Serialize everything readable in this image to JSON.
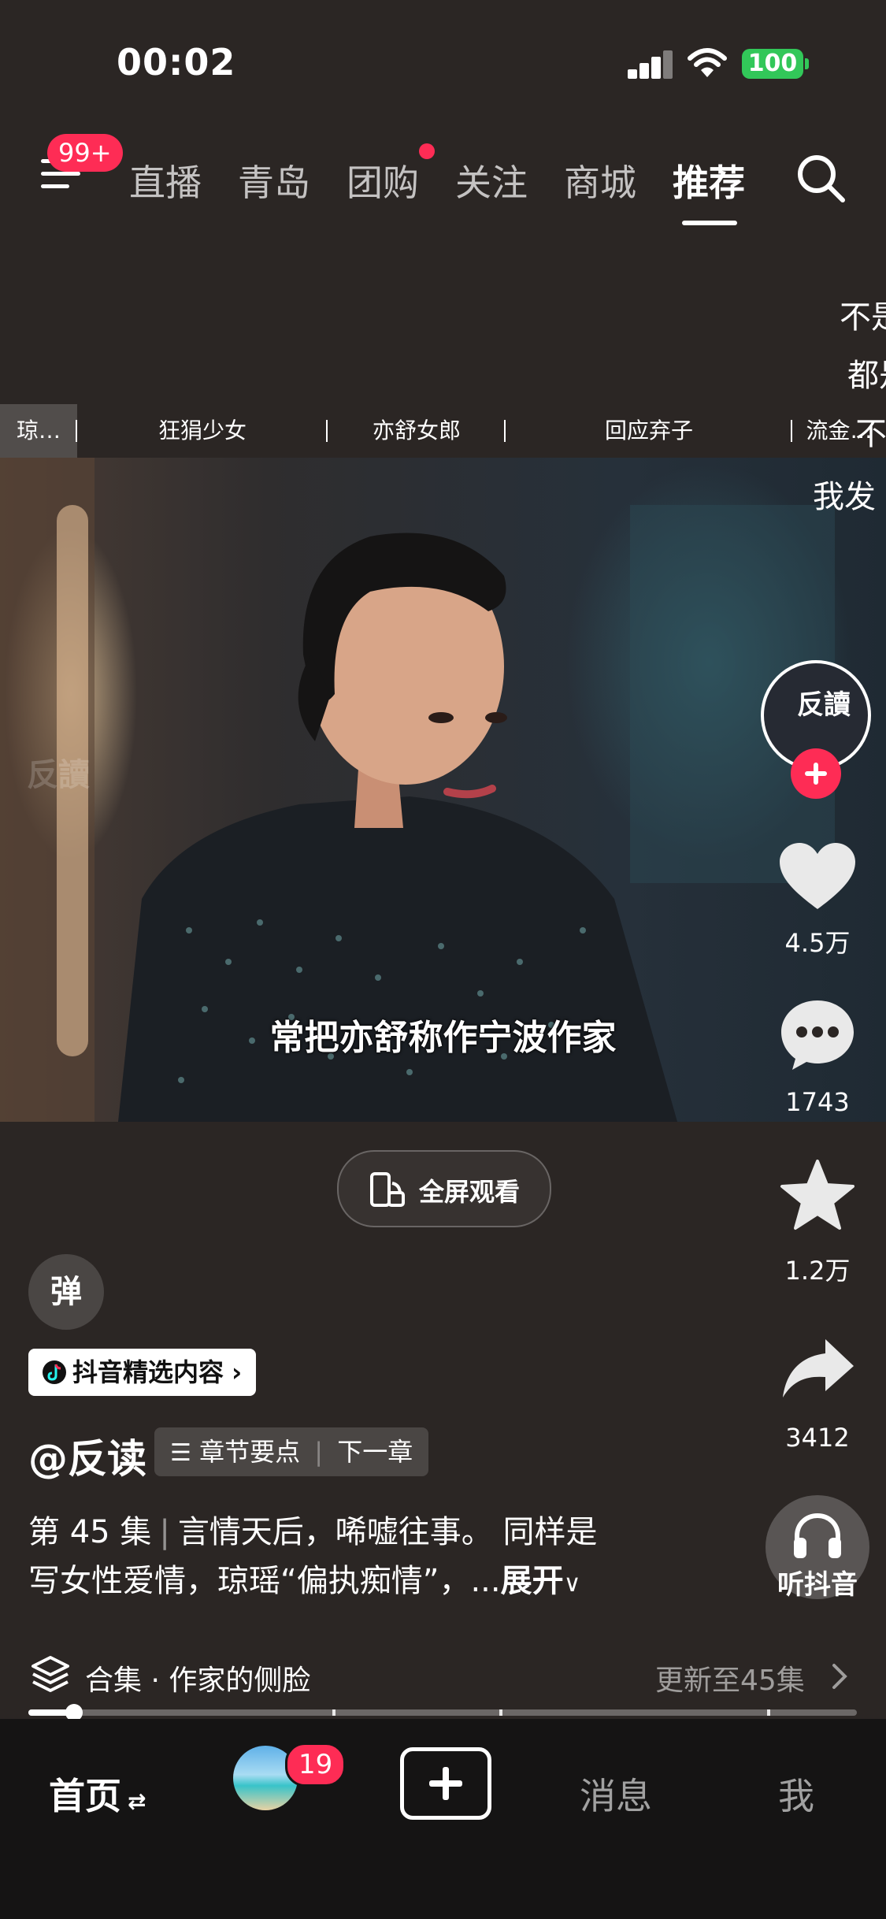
{
  "status_bar": {
    "time": "00:02",
    "battery": "100",
    "accent": "#32c759"
  },
  "top_nav": {
    "menu_badge": "99+",
    "tabs": [
      "直播",
      "青岛",
      "团购",
      "关注",
      "商城",
      "推荐"
    ],
    "active_tab": "推荐",
    "group_dot_color": "#fe2c55"
  },
  "danmaku": [
    "不是",
    "都是",
    "不",
    "我发"
  ],
  "chapter_strip": [
    "琼…",
    "狂狷少女",
    "亦舒女郎",
    "回应弃子",
    "流金…"
  ],
  "video": {
    "subtitle": "常把亦舒称作宁波作家",
    "watermark": "反讀"
  },
  "fullscreen": {
    "label": "全屏观看"
  },
  "sidebar": {
    "avatar_text": "反讀",
    "like_count": "4.5万",
    "comment_count": "1743",
    "favorite_count": "1.2万",
    "share_count": "3412",
    "listen_label": "听抖音"
  },
  "info": {
    "danmu_label": "弹",
    "featured_tag": "抖音精选内容",
    "author": "@反读",
    "chapter_points": "章节要点",
    "next_chapter": "下一章",
    "episode": "第 45 集",
    "desc_line1": "言情天后，唏嘘往事。 同样是",
    "desc_line2": "写女性爱情，琼瑶“偏执痴情”，...",
    "expand": "展开"
  },
  "collection": {
    "title": "合集 · 作家的侧脸",
    "update": "更新至45集",
    "progress_fraction": 0.055
  },
  "bottom_nav": {
    "home": "首页",
    "friends_badge": "19",
    "messages": "消息",
    "me": "我"
  }
}
